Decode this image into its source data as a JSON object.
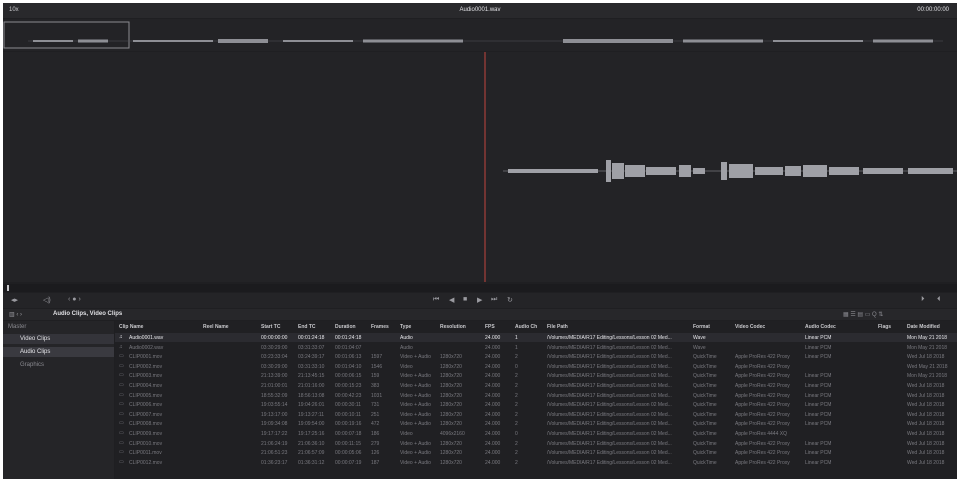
{
  "topbar": {
    "zoom": "10x",
    "title": "Audio0001.wav",
    "timecode": "00:00:00:00"
  },
  "transport": {
    "icons": [
      "jump-to-start-icon",
      "step-back-icon",
      "stop-icon",
      "play-icon",
      "jump-to-end-icon",
      "loop-icon"
    ]
  },
  "browser": {
    "path": "Audio Clips, Video Clips"
  },
  "sidebar": {
    "root": "Master",
    "bins": [
      "Video Clips",
      "Audio Clips",
      "Graphics"
    ]
  },
  "table": {
    "columns": [
      "Clip Name",
      "Reel Name",
      "Start TC",
      "End TC",
      "Duration",
      "Frames",
      "Type",
      "Resolution",
      "FPS",
      "Audio Ch",
      "File Path",
      "Format",
      "Video Codec",
      "Audio Codec",
      "Flags",
      "Date Modified"
    ],
    "rows": [
      [
        "Audio0001.wav",
        "",
        "00:00:00:00",
        "00:01:24:18",
        "00:01:24:18",
        "",
        "Audio",
        "",
        "24.000",
        "1",
        "/Volumes/MEDIA/R17 Editing/Lessons/Lesson 02 Med...",
        "Wave",
        "",
        "Linear PCM",
        "",
        "Mon May 21 2018"
      ],
      [
        "Audio0002.wav",
        "",
        "03:30:29:00",
        "03:31:33:07",
        "00:01:04:07",
        "",
        "Audio",
        "",
        "24.000",
        "1",
        "/Volumes/MEDIA/R17 Editing/Lessons/Lesson 02 Med...",
        "Wave",
        "",
        "Linear PCM",
        "",
        "Mon May 21 2018"
      ],
      [
        "CLIP0001.mov",
        "",
        "03:23:33:04",
        "03:24:39:17",
        "00:01:06:13",
        "1597",
        "Video + Audio",
        "1280x720",
        "24.000",
        "2",
        "/Volumes/MEDIA/R17 Editing/Lessons/Lesson 02 Med...",
        "QuickTime",
        "Apple ProRes 422 Proxy",
        "Linear PCM",
        "",
        "Wed Jul 18 2018"
      ],
      [
        "CLIP0002.mov",
        "",
        "03:30:29:00",
        "03:31:33:10",
        "00:01:04:10",
        "1546",
        "Video",
        "1280x720",
        "24.000",
        "0",
        "/Volumes/MEDIA/R17 Editing/Lessons/Lesson 02 Med...",
        "QuickTime",
        "Apple ProRes 422 Proxy",
        "",
        "",
        "Wed May 21 2018"
      ],
      [
        "CLIP0003.mov",
        "",
        "21:13:39:00",
        "21:13:45:15",
        "00:00:06:15",
        "159",
        "Video + Audio",
        "1280x720",
        "24.000",
        "2",
        "/Volumes/MEDIA/R17 Editing/Lessons/Lesson 02 Med...",
        "QuickTime",
        "Apple ProRes 422 Proxy",
        "Linear PCM",
        "",
        "Mon May 21 2018"
      ],
      [
        "CLIP0004.mov",
        "",
        "21:01:00:01",
        "21:01:16:00",
        "00:00:15:23",
        "383",
        "Video + Audio",
        "1280x720",
        "24.000",
        "2",
        "/Volumes/MEDIA/R17 Editing/Lessons/Lesson 02 Med...",
        "QuickTime",
        "Apple ProRes 422 Proxy",
        "Linear PCM",
        "",
        "Wed Jul 18 2018"
      ],
      [
        "CLIP0005.mov",
        "",
        "18:55:32:09",
        "18:56:13:08",
        "00:00:42:23",
        "1031",
        "Video + Audio",
        "1280x720",
        "24.000",
        "2",
        "/Volumes/MEDIA/R17 Editing/Lessons/Lesson 02 Med...",
        "QuickTime",
        "Apple ProRes 422 Proxy",
        "Linear PCM",
        "",
        "Wed Jul 18 2018"
      ],
      [
        "CLIP0006.mov",
        "",
        "19:03:55:14",
        "19:04:26:01",
        "00:00:30:11",
        "731",
        "Video + Audio",
        "1280x720",
        "24.000",
        "2",
        "/Volumes/MEDIA/R17 Editing/Lessons/Lesson 02 Med...",
        "QuickTime",
        "Apple ProRes 422 Proxy",
        "Linear PCM",
        "",
        "Wed Jul 18 2018"
      ],
      [
        "CLIP0007.mov",
        "",
        "19:13:17:00",
        "19:13:27:11",
        "00:00:10:11",
        "251",
        "Video + Audio",
        "1280x720",
        "24.000",
        "2",
        "/Volumes/MEDIA/R17 Editing/Lessons/Lesson 02 Med...",
        "QuickTime",
        "Apple ProRes 422 Proxy",
        "Linear PCM",
        "",
        "Wed Jul 18 2018"
      ],
      [
        "CLIP0008.mov",
        "",
        "19:09:34:08",
        "19:09:54:00",
        "00:00:19:16",
        "472",
        "Video + Audio",
        "1280x720",
        "24.000",
        "2",
        "/Volumes/MEDIA/R17 Editing/Lessons/Lesson 02 Med...",
        "QuickTime",
        "Apple ProRes 422 Proxy",
        "Linear PCM",
        "",
        "Wed Jul 18 2018"
      ],
      [
        "CLIP0009.mov",
        "",
        "19:17:17:22",
        "19:17:25:16",
        "00:00:07:18",
        "186",
        "Video",
        "4096x2160",
        "24.000",
        "0",
        "/Volumes/MEDIA/R17 Editing/Lessons/Lesson 02 Med...",
        "QuickTime",
        "Apple ProRes 4444 XQ",
        "",
        "",
        "Wed Jul 18 2018"
      ],
      [
        "CLIP0010.mov",
        "",
        "21:06:24:19",
        "21:06:36:10",
        "00:00:11:15",
        "279",
        "Video + Audio",
        "1280x720",
        "24.000",
        "2",
        "/Volumes/MEDIA/R17 Editing/Lessons/Lesson 02 Med...",
        "QuickTime",
        "Apple ProRes 422 Proxy",
        "Linear PCM",
        "",
        "Wed Jul 18 2018"
      ],
      [
        "CLIP0011.mov",
        "",
        "21:06:51:23",
        "21:06:57:09",
        "00:00:05:06",
        "126",
        "Video + Audio",
        "1280x720",
        "24.000",
        "2",
        "/Volumes/MEDIA/R17 Editing/Lessons/Lesson 02 Med...",
        "QuickTime",
        "Apple ProRes 422 Proxy",
        "Linear PCM",
        "",
        "Wed Jul 18 2018"
      ],
      [
        "CLIP0012.mov",
        "",
        "01:36:23:17",
        "01:36:31:12",
        "00:00:07:19",
        "187",
        "Video + Audio",
        "1280x720",
        "24.000",
        "2",
        "/Volumes/MEDIA/R17 Editing/Lessons/Lesson 02 Med...",
        "QuickTime",
        "Apple ProRes 422 Proxy",
        "Linear PCM",
        "",
        "Wed Jul 18 2018"
      ]
    ]
  },
  "colors": {
    "playhead": "#c1443f",
    "waveform": "#9fa0a6",
    "background": "#1f1f22"
  }
}
